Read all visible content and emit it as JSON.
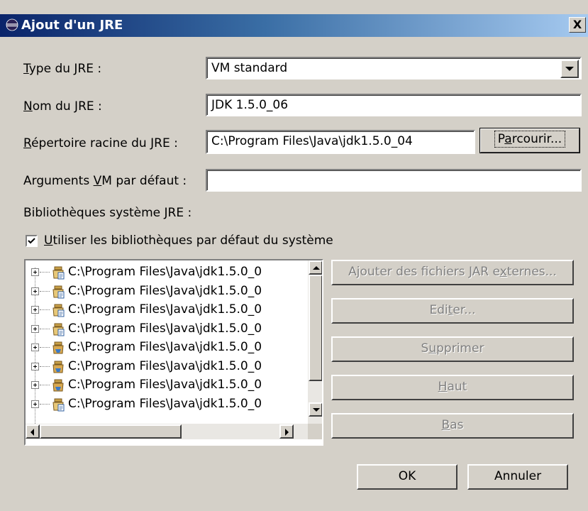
{
  "window": {
    "title": "Ajout d'un JRE",
    "close_label": "X"
  },
  "form": {
    "type_label_u": "T",
    "type_label_rest": "ype du JRE :",
    "type_value": "VM standard",
    "name_label_u": "N",
    "name_label_rest": "om du JRE :",
    "name_value": "JDK 1.5.0_06",
    "home_label_u": "R",
    "home_label_rest": "épertoire racine du JRE :",
    "home_value": "C:\\Program Files\\Java\\jdk1.5.0_04",
    "browse_pre": "P",
    "browse_u": "a",
    "browse_post": "rcourir...",
    "args_label_pre": "Arguments ",
    "args_label_u": "V",
    "args_label_post": "M par défaut :",
    "args_value": "",
    "libs_label": "Bibliothèques système JRE :",
    "default_libs_u": "U",
    "default_libs_rest": "tiliser les bibliothèques par défaut du système",
    "default_libs_checked": true
  },
  "libraries": [
    {
      "path": "C:\\Program Files\\Java\\jdk1.5.0_0",
      "icon": "jar-source-icon"
    },
    {
      "path": "C:\\Program Files\\Java\\jdk1.5.0_0",
      "icon": "jar-source-icon"
    },
    {
      "path": "C:\\Program Files\\Java\\jdk1.5.0_0",
      "icon": "jar-source-icon"
    },
    {
      "path": "C:\\Program Files\\Java\\jdk1.5.0_0",
      "icon": "jar-source-icon"
    },
    {
      "path": "C:\\Program Files\\Java\\jdk1.5.0_0",
      "icon": "jar-icon"
    },
    {
      "path": "C:\\Program Files\\Java\\jdk1.5.0_0",
      "icon": "jar-icon"
    },
    {
      "path": "C:\\Program Files\\Java\\jdk1.5.0_0",
      "icon": "jar-icon"
    },
    {
      "path": "C:\\Program Files\\Java\\jdk1.5.0_0",
      "icon": "jar-source-icon"
    }
  ],
  "side_buttons": {
    "add_ext_pre": "Ajouter des fichiers JAR e",
    "add_ext_u": "x",
    "add_ext_post": "ternes...",
    "edit_pre": "Edi",
    "edit_u": "t",
    "edit_post": "er...",
    "remove_pre": "S",
    "remove_u": "u",
    "remove_post": "pprimer",
    "up_u": "H",
    "up_post": "aut",
    "down_u": "B",
    "down_post": "as"
  },
  "footer": {
    "ok_label": "OK",
    "cancel_label": "Annuler"
  },
  "colors": {
    "dialog_bg": "#d4d0c8",
    "title_start": "#0a246a",
    "title_end": "#a6caf0",
    "disabled_text": "#808080"
  }
}
